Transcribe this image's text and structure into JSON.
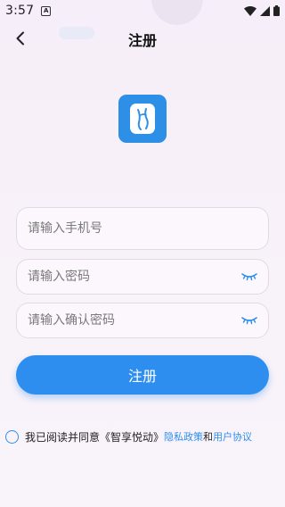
{
  "status_bar": {
    "time": "3:57",
    "notification_icon": "a-box-icon",
    "icons": [
      "wifi-icon",
      "signal-icon",
      "battery-icon"
    ]
  },
  "nav": {
    "back_icon": "chevron-left-icon",
    "title": "注册"
  },
  "logo": {
    "icon": "app-logo-icon",
    "color": "#2e8fe6"
  },
  "form": {
    "phone_placeholder": "请输入手机号",
    "password_placeholder": "请输入密码",
    "confirm_placeholder": "请输入确认密码",
    "eye_icon": "eye-closed-icon",
    "submit_label": "注册"
  },
  "agreement": {
    "checked": false,
    "text": "我已阅读并同意《智享悦动》",
    "privacy_link": "隐私政策",
    "and_text": "和",
    "terms_link": "用户协议"
  },
  "colors": {
    "accent": "#2d8ef0",
    "background": "#f7f0f8"
  }
}
